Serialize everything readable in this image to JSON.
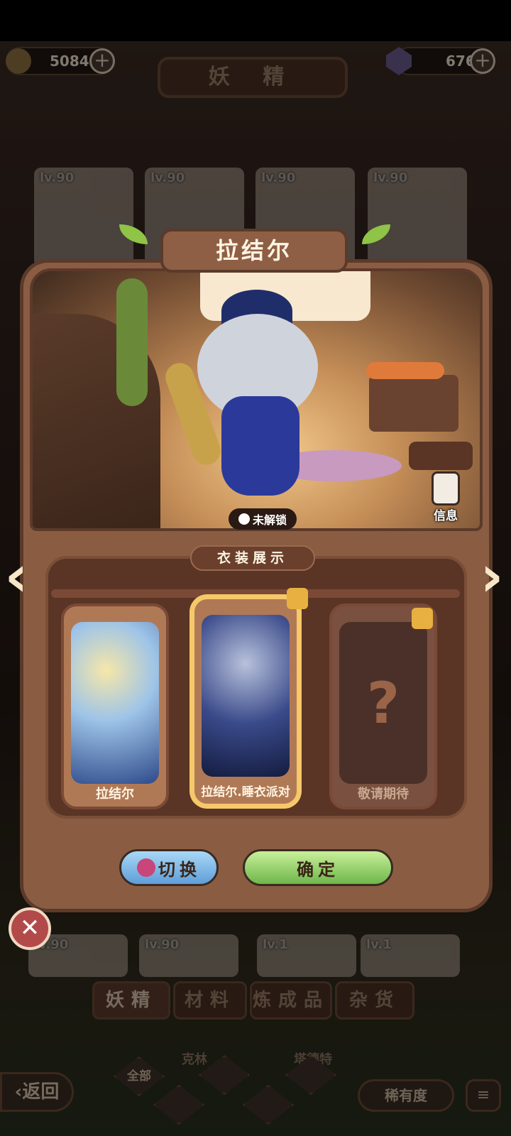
{
  "header": {
    "gold_amount": "50840",
    "gem_amount": "676",
    "title": "妖 精"
  },
  "background_cards": [
    {
      "level": "lv.90"
    },
    {
      "level": "lv.90"
    },
    {
      "level": "lv.90"
    },
    {
      "level": "lv.90"
    }
  ],
  "bottom_cards": [
    {
      "level": "lv.90"
    },
    {
      "level": "lv.90"
    },
    {
      "level": "lv.1"
    },
    {
      "level": "lv.1"
    }
  ],
  "bottom_names": [
    "克林",
    "塔德特"
  ],
  "modal": {
    "character_name": "拉结尔",
    "lock_status": "未解锁",
    "info_label": "信息",
    "section_title": "衣装展示",
    "outfits": [
      {
        "name": "拉结尔",
        "locked": false
      },
      {
        "name": "拉结尔.睡衣派对",
        "locked": true,
        "selected": true
      },
      {
        "name": "敬请期待",
        "locked": true
      }
    ],
    "switch_label": "切换",
    "confirm_label": "确定",
    "prev_arrow": "‹",
    "next_arrow": "›",
    "close_symbol": "✕"
  },
  "tabs": [
    "妖精",
    "材料",
    "炼成品",
    "杂货"
  ],
  "filters": {
    "all_label": "全部",
    "rarity_label": "稀有度",
    "sort_symbol": "≡"
  },
  "back_label": "‹返回",
  "colors": {
    "accent_gold": "#f6c86a",
    "switch_button": "#5f9ed8",
    "confirm_button": "#6fb64a",
    "close_button": "#b34a4a"
  }
}
